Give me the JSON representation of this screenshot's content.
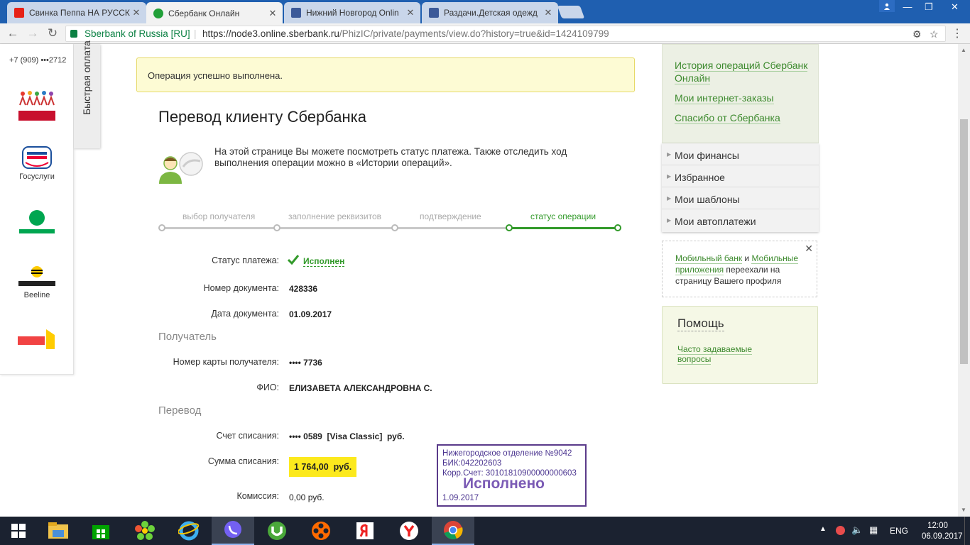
{
  "browser": {
    "tabs": [
      {
        "title": "Свинка Пеппа НА РУССК",
        "icon": "youtube-icon",
        "color": "#e62117"
      },
      {
        "title": "Сбербанк Онлайн",
        "icon": "sberbank-icon",
        "color": "#21a038"
      },
      {
        "title": "Нижний Новгород Onlin",
        "icon": "nn-icon",
        "color": "#3c5a99"
      },
      {
        "title": "Раздачи.Детская одежд",
        "icon": "nn-icon",
        "color": "#3c5a99"
      }
    ],
    "window_controls": {
      "minimize": "—",
      "restore": "❐",
      "close": "✕"
    },
    "security_label": "Sberbank of Russia [RU]",
    "url_host": "https://node3.online.sberbank.ru",
    "url_path": "/PhizIC/private/payments/view.do?history=true&id=1424109799"
  },
  "left_panel": {
    "phone": "+7 (909) •••2712",
    "quick_pay_label": "Быстрая оплата",
    "items": [
      {
        "label": "",
        "logo_text": "Пиши мне!"
      },
      {
        "label": "Госуслуги",
        "logo_text": "ГОС УСЛУГИ"
      },
      {
        "label": "",
        "logo_text": "МегаФон"
      },
      {
        "label": "Beeline",
        "logo_text": "БИЛАЙН"
      },
      {
        "label": "",
        "logo_text": "Яндекс"
      }
    ]
  },
  "notice": "Операция успешно выполнена.",
  "title": "Перевод клиенту Сбербанка",
  "intro": "На этой странице Вы можете посмотреть статус платежа. Также отследить ход выполнения операции можно в «Истории операций».",
  "steps": [
    "выбор получателя",
    "заполнение реквизитов",
    "подтверждение",
    "статус операции"
  ],
  "details": {
    "status_label": "Статус платежа:",
    "status_value": "Исполнен",
    "doc_number_label": "Номер документа:",
    "doc_number": "428336",
    "doc_date_label": "Дата документа:",
    "doc_date": "01.09.2017",
    "recipient_section": "Получатель",
    "card_label": "Номер карты получателя:",
    "card_value": "•••• 7736",
    "fio_label": "ФИО:",
    "fio_value": "ЕЛИЗАВЕТА АЛЕКСАНДРОВНА С.",
    "transfer_section": "Перевод",
    "account_label": "Счет списания:",
    "account_value": "•••• 0589  [Visa Classic]  руб.",
    "amount_label": "Сумма списания:",
    "amount_value": "1 764,00  руб.",
    "fee_label": "Комиссия:",
    "fee_value": "0,00 руб."
  },
  "stamp": {
    "line1": "Нижегородское отделение №9042",
    "line2": "БИК:042202603",
    "line3": "Корр.Счет: 30101810900000000603",
    "status": "Исполнено",
    "date": "1.09.2017"
  },
  "right_sidebar": {
    "links": [
      "История операций Сбербанк Онлайн",
      "Мои интернет-заказы",
      "Спасибо от Сбербанка"
    ],
    "menu": [
      "Мои финансы",
      "Избранное",
      "Мои шаблоны",
      "Мои автоплатежи"
    ],
    "mobile_note": {
      "link1": "Мобильный банк",
      "and": " и ",
      "link2": "Мобильные приложения",
      "rest": " переехали на страницу Вашего профиля"
    },
    "help_title": "Помощь",
    "help_link": "Часто задаваемые вопросы"
  },
  "taskbar": {
    "lang": "ENG",
    "time": "12:00",
    "date": "06.09.2017"
  }
}
